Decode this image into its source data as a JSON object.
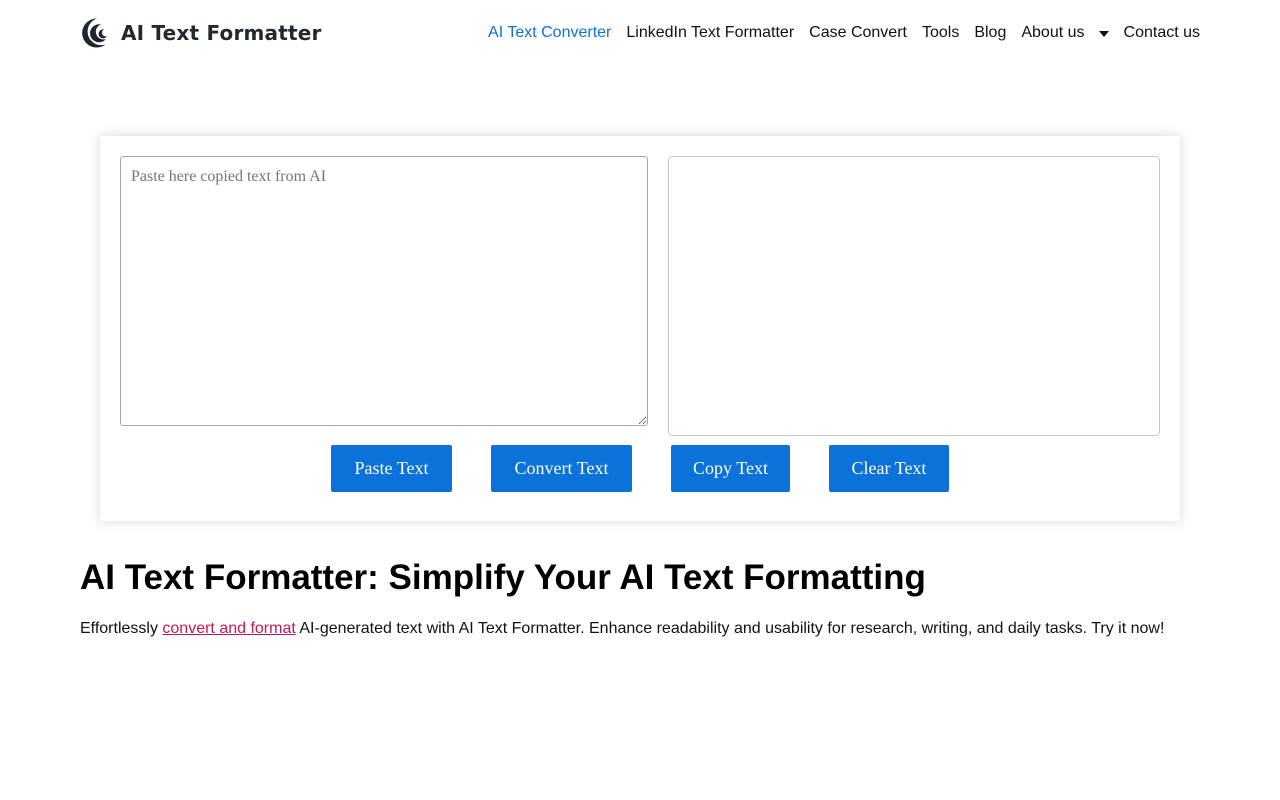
{
  "brand": {
    "name": "AI Text Formatter",
    "logo_icon": "crescent-swoosh-icon",
    "logo_color": "#1e2530"
  },
  "nav": {
    "items": [
      {
        "label": "AI Text Converter",
        "active": true
      },
      {
        "label": "LinkedIn Text Formatter"
      },
      {
        "label": "Case Convert"
      },
      {
        "label": "Tools"
      },
      {
        "label": "Blog"
      },
      {
        "label": "About us",
        "dropdown": true,
        "icon": "chevron-down-icon"
      },
      {
        "label": "Contact us"
      }
    ],
    "active_color": "#0b72d6"
  },
  "converter": {
    "input_placeholder": "Paste here copied text from AI",
    "input_value": "",
    "output_value": "",
    "buttons": {
      "paste": "Paste Text",
      "convert": "Convert Text",
      "copy": "Copy Text",
      "clear": "Clear Text"
    },
    "button_color": "#0a72d8"
  },
  "content": {
    "title": "AI Text Formatter: Simplify Your AI Text Formatting",
    "intro_before": "Effortlessly ",
    "intro_link": "convert and format",
    "intro_after": " AI-generated text with AI Text Formatter. Enhance readability and usability for research, writing, and daily tasks. Try it now!",
    "link_color": "#c2185b"
  }
}
